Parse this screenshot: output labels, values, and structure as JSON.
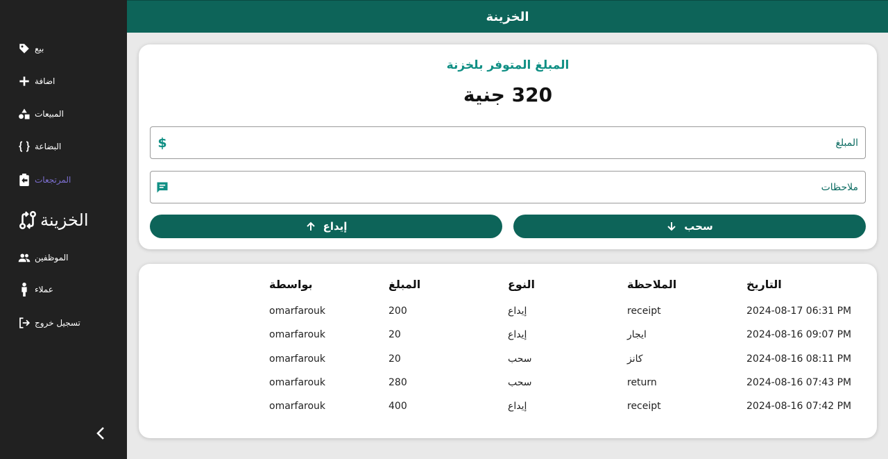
{
  "header": {
    "title": "الخزينة"
  },
  "sidebar": {
    "items": [
      {
        "label": "بيع",
        "icon": "tag-icon"
      },
      {
        "label": "اضافة",
        "icon": "plus-icon"
      },
      {
        "label": "المبيعات",
        "icon": "shapes-icon"
      },
      {
        "label": "البضاعة",
        "icon": "braces-icon"
      },
      {
        "label": "المرتجعات",
        "icon": "clipboard-return-icon"
      },
      {
        "label": "الخزينة",
        "icon": "git-compare-icon"
      },
      {
        "label": "الموظفين",
        "icon": "users-icon"
      },
      {
        "label": "عملاء",
        "icon": "person-icon"
      },
      {
        "label": "تسجيل خروج",
        "icon": "logout-icon"
      }
    ],
    "colors": {
      "active_purple": "#7c6fd0"
    }
  },
  "treasury": {
    "available_label": "المبلغ المتوفر بلخزنة",
    "available_amount": "320 جنية",
    "amount_placeholder": "المبلغ",
    "notes_placeholder": "ملاحظات",
    "withdraw_label": "سحب",
    "deposit_label": "إيداع"
  },
  "table": {
    "headers": {
      "date": "التاريخ",
      "note": "الملاحظة",
      "type": "النوع",
      "amount": "المبلغ",
      "by": "بواسطة"
    },
    "rows": [
      {
        "date": "2024-08-17 06:31 PM",
        "note": "receipt",
        "type": "إيداع",
        "amount": "200",
        "by": "omarfarouk"
      },
      {
        "date": "2024-08-16 09:07 PM",
        "note": "ايجار",
        "type": "إيداع",
        "amount": "20",
        "by": "omarfarouk"
      },
      {
        "date": "2024-08-16 08:11 PM",
        "note": "كانز",
        "type": "سحب",
        "amount": "20",
        "by": "omarfarouk"
      },
      {
        "date": "2024-08-16 07:43 PM",
        "note": "return",
        "type": "سحب",
        "amount": "280",
        "by": "omarfarouk"
      },
      {
        "date": "2024-08-16 07:42 PM",
        "note": "receipt",
        "type": "إيداع",
        "amount": "400",
        "by": "omarfarouk"
      }
    ]
  },
  "colors": {
    "primary": "#0d6459",
    "accent": "#0f8f84",
    "sidebar_bg": "#212121"
  }
}
